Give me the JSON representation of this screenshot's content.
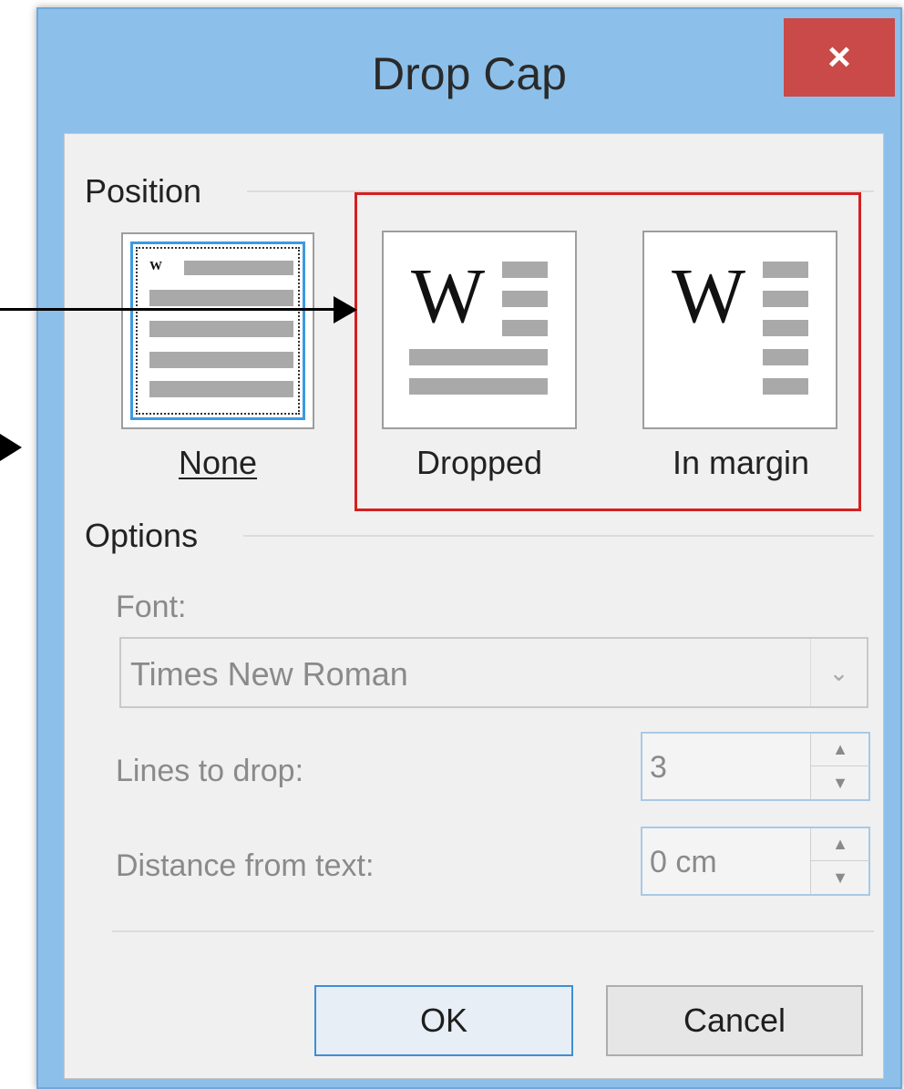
{
  "dialog": {
    "title": "Drop Cap",
    "close_glyph": "×"
  },
  "position": {
    "label": "Position",
    "options": [
      {
        "caption": "None",
        "selected": true,
        "icon_letter": "W"
      },
      {
        "caption": "Dropped",
        "selected": false,
        "icon_letter": "W"
      },
      {
        "caption": "In margin",
        "selected": false,
        "icon_letter": "W"
      }
    ]
  },
  "options": {
    "label": "Options",
    "font": {
      "label": "Font:",
      "value": "Times New Roman"
    },
    "lines_to_drop": {
      "label": "Lines to drop:",
      "value": "3"
    },
    "distance_from_text": {
      "label": "Distance from text:",
      "value": "0 cm"
    }
  },
  "buttons": {
    "ok": "OK",
    "cancel": "Cancel"
  },
  "colors": {
    "title_bar": "#8cc0ea",
    "close_button": "#c94a48",
    "highlight_box": "#d42020",
    "selection_border": "#3c9ae0"
  }
}
